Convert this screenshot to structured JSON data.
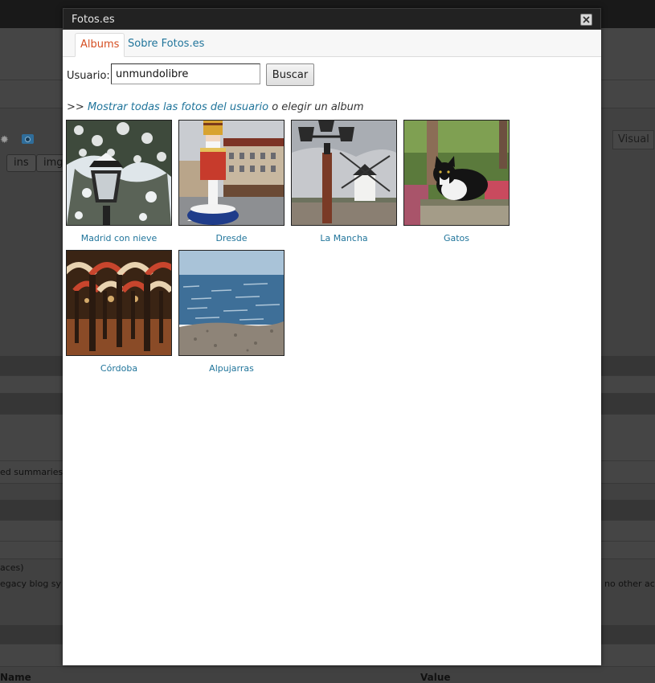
{
  "background": {
    "button_ins": "ins",
    "button_img": "img",
    "visual_tab": "Visual",
    "text_summaries": "ed summaries",
    "text_aces": "aces)",
    "text_legacy": "egacy blog sy",
    "text_no_other": "no other ac",
    "col_name": "Name",
    "col_value": "Value"
  },
  "modal": {
    "title": "Fotos.es",
    "close_icon": "close-icon"
  },
  "tabs": [
    {
      "label": "Albums",
      "active": true
    },
    {
      "label": "Sobre Fotos.es",
      "active": false
    }
  ],
  "search": {
    "label": "Usuario:",
    "value": "unmundolibre",
    "button": "Buscar"
  },
  "links": {
    "prefix": ">>",
    "show_all": "Mostrar todas las fotos del usuario",
    "or_choose": "o elegir un album"
  },
  "albums": [
    {
      "title": "Madrid con nieve"
    },
    {
      "title": "Dresde"
    },
    {
      "title": "La Mancha"
    },
    {
      "title": "Gatos"
    },
    {
      "title": "Córdoba"
    },
    {
      "title": "Alpujarras"
    }
  ],
  "colors": {
    "link": "#21759b",
    "active_tab": "#d54e21",
    "titlebar": "#222222"
  }
}
